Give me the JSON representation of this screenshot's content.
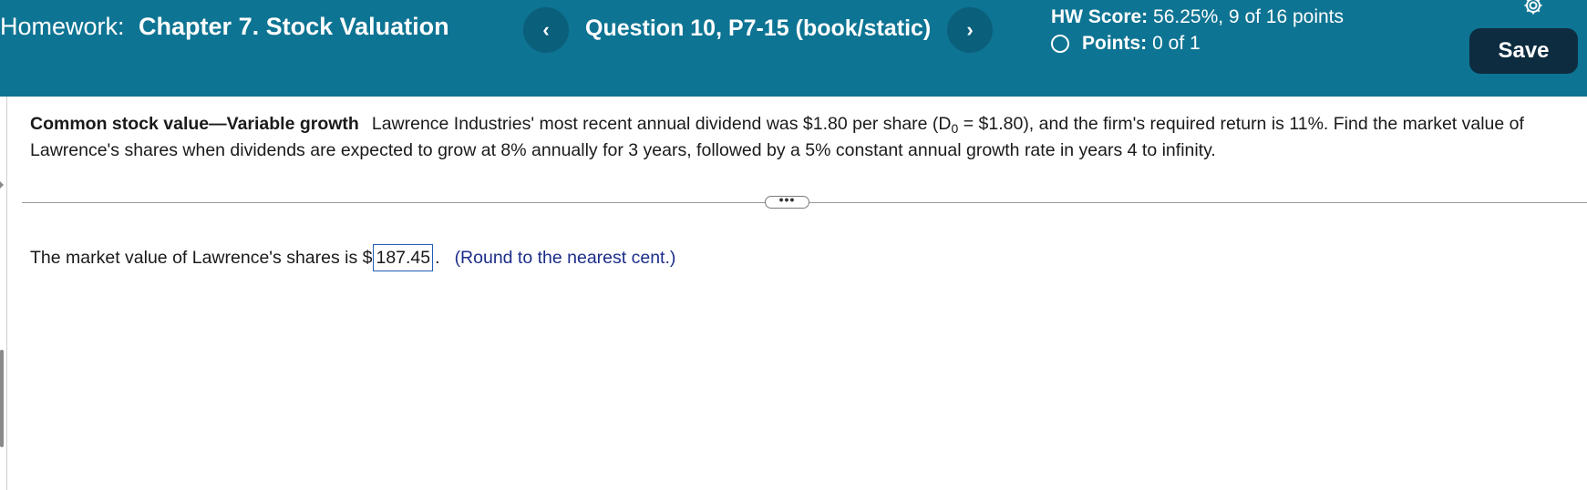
{
  "header": {
    "homework_prefix": "Homework:",
    "chapter_title": "Chapter 7. Stock Valuation",
    "prev_label": "‹",
    "next_label": "›",
    "question_label": "Question 10, P7-15 (book/static)",
    "hw_score_label": "HW Score:",
    "hw_score_value": "56.25%, 9 of 16 points",
    "points_label": "Points:",
    "points_value": "0 of 1",
    "save_label": "Save",
    "icons": {
      "settings": "gear-icon",
      "points_status": "radio-circle-icon"
    },
    "colors": {
      "header_bg": "#0e7493",
      "save_bg": "#0d2c40"
    }
  },
  "problem": {
    "topic": "Common stock value—Variable growth",
    "text_before_sub": "Lawrence Industries' most recent annual dividend was $1.80 per share (D",
    "subscript": "0",
    "text_after_sub": " = $1.80), and the firm's required return is 11%.  Find the market value of Lawrence's shares when dividends are expected to grow at 8% annually for 3 years, followed by a 5% constant annual growth rate in years 4 to infinity."
  },
  "expand_button": {
    "label": "•••"
  },
  "answer": {
    "prefix": "The market value of Lawrence's shares is $",
    "value": "187.45",
    "suffix": ".",
    "hint": "(Round to the nearest cent.)"
  }
}
